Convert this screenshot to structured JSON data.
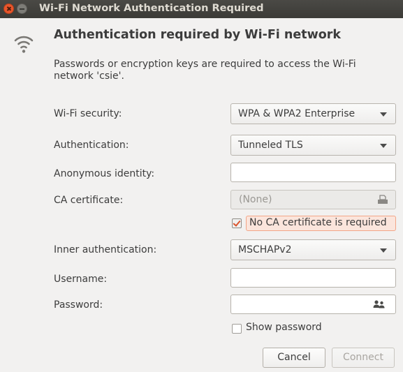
{
  "window": {
    "title": "Wi-Fi Network Authentication Required"
  },
  "icons": {
    "wifi": "wifi-signal-icon",
    "file": "file-chooser-icon",
    "people": "people-icon",
    "close": "close-icon",
    "minimize": "minimize-icon"
  },
  "header": {
    "title": "Authentication required by Wi-Fi network",
    "description": "Passwords or encryption keys are required to access the Wi-Fi network 'csie'."
  },
  "form": {
    "security": {
      "label": "Wi-Fi security:",
      "value": "WPA & WPA2 Enterprise"
    },
    "authentication": {
      "label": "Authentication:",
      "value": "Tunneled TLS"
    },
    "anonymous_identity": {
      "label": "Anonymous identity:",
      "value": ""
    },
    "ca_certificate": {
      "label": "CA certificate:",
      "value": "(None)"
    },
    "no_ca_required": {
      "label": "No CA certificate is required",
      "checked": true
    },
    "inner_authentication": {
      "label": "Inner authentication:",
      "value": "MSCHAPv2"
    },
    "username": {
      "label": "Username:",
      "value": ""
    },
    "password": {
      "label": "Password:",
      "value": ""
    },
    "show_password": {
      "label": "Show password",
      "checked": false
    }
  },
  "buttons": {
    "cancel": "Cancel",
    "connect": "Connect"
  },
  "colors": {
    "accent": "#e9562c",
    "titlebar": "#3c3b37",
    "background": "#f2f1f0"
  }
}
